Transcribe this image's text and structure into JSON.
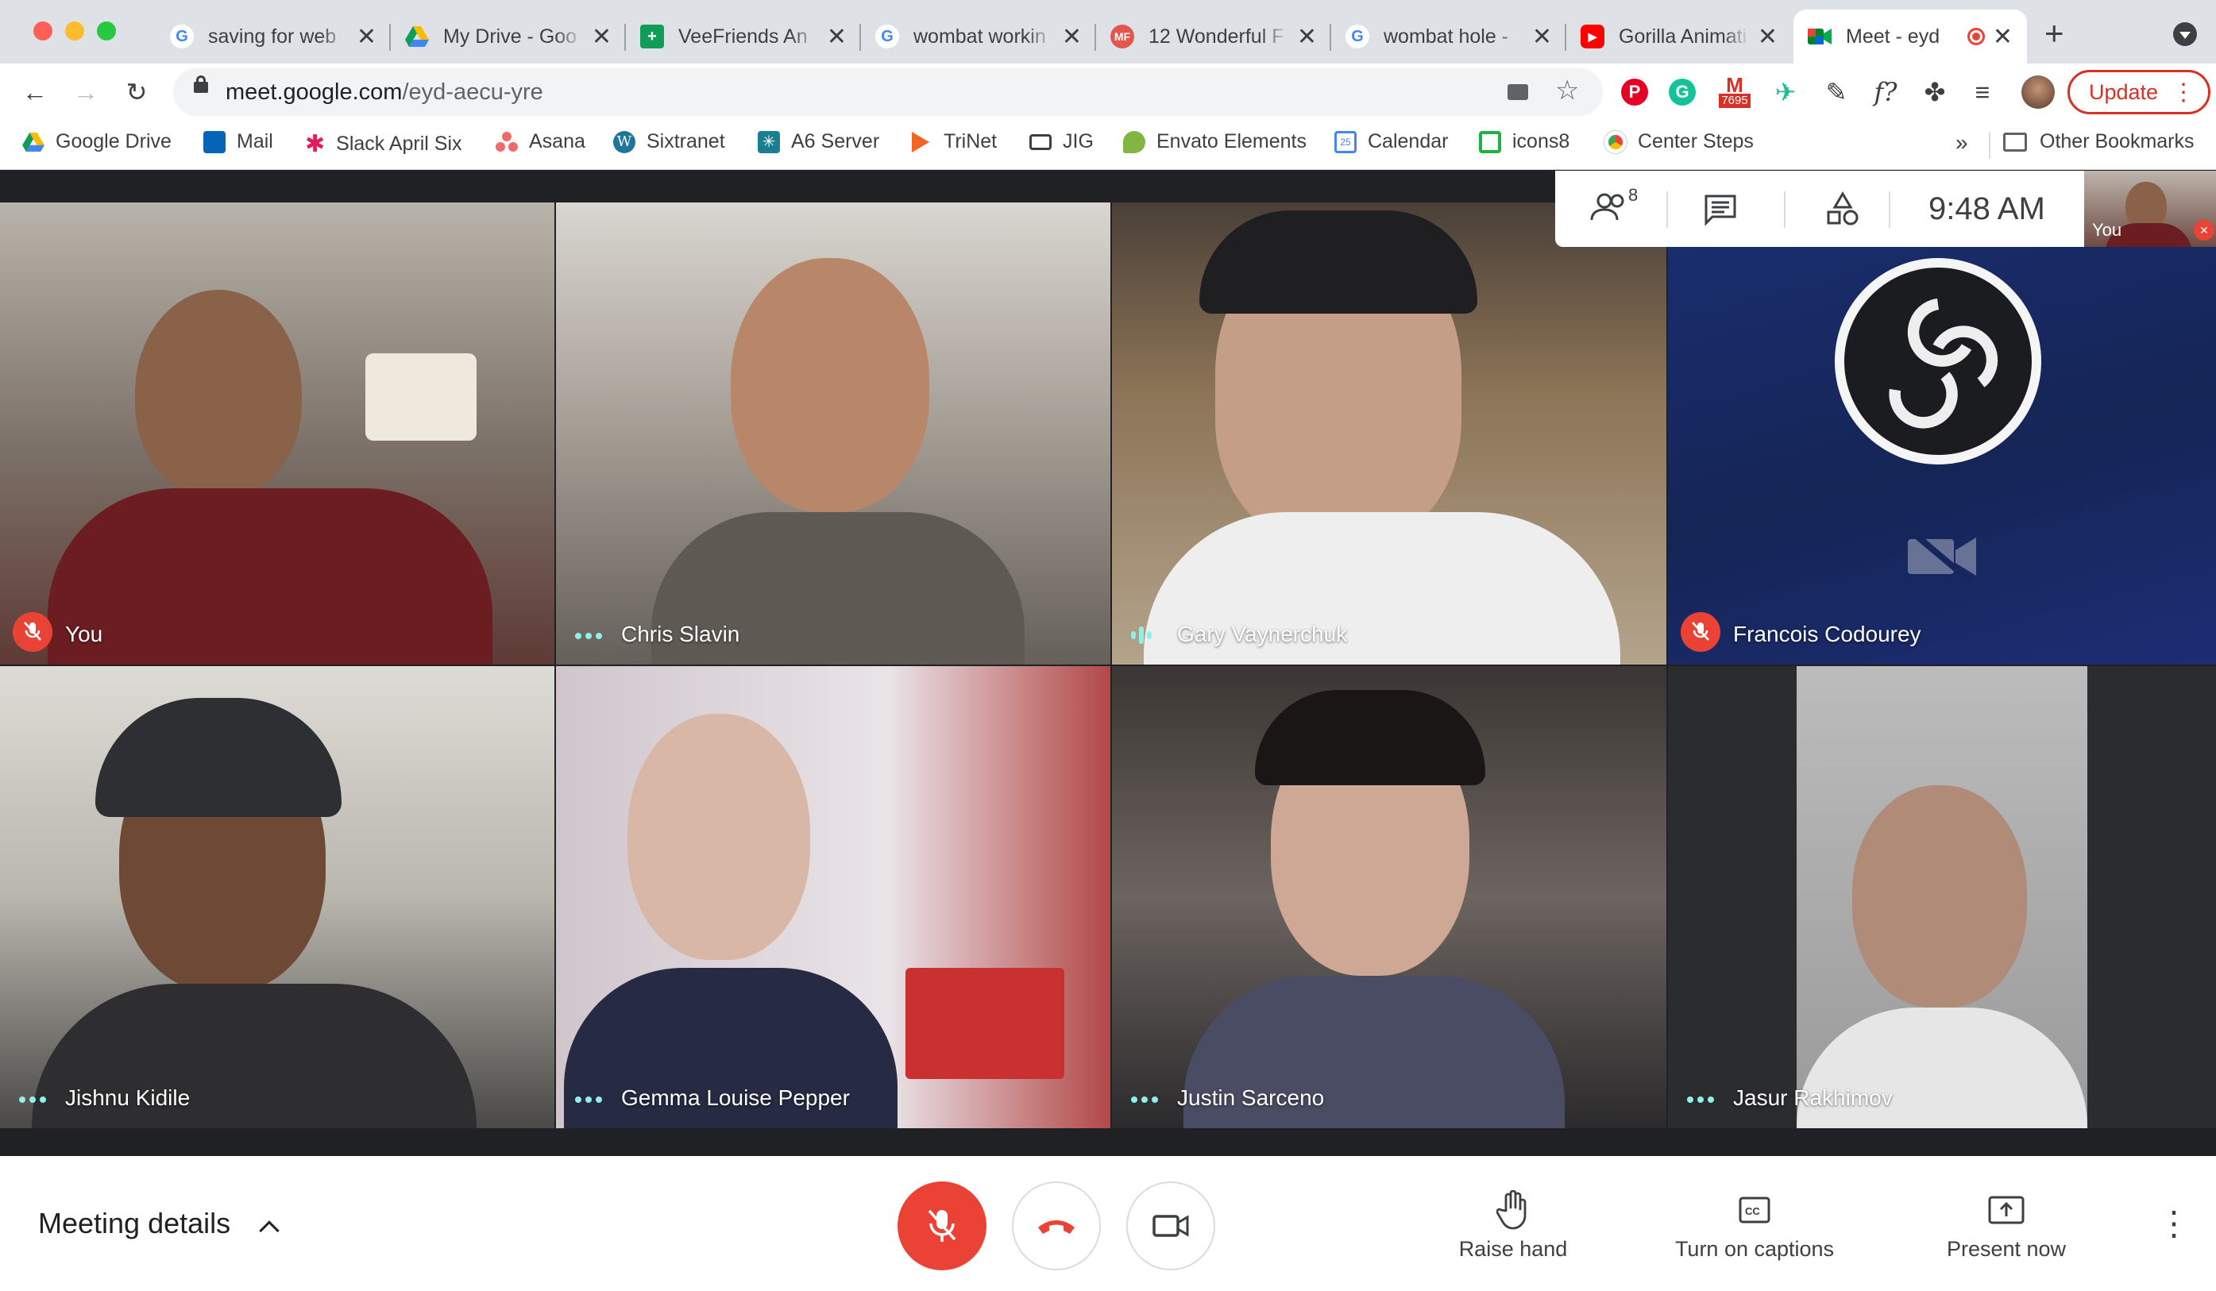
{
  "tabs": [
    {
      "title": "saving for web",
      "favicon": "google-icon"
    },
    {
      "title": "My Drive - Goo",
      "favicon": "google-drive-icon"
    },
    {
      "title": "VeeFriends An",
      "favicon": "google-sheets-icon"
    },
    {
      "title": "wombat workin",
      "favicon": "google-icon"
    },
    {
      "title": "12 Wonderful F",
      "favicon": "mf-icon",
      "favicon_text": "MF"
    },
    {
      "title": "wombat hole -",
      "favicon": "google-icon"
    },
    {
      "title": "Gorilla Animati",
      "favicon": "youtube-icon"
    },
    {
      "title": "Meet - eyd",
      "favicon": "google-meet-icon",
      "active": true
    }
  ],
  "address": {
    "host": "meet.google.com",
    "path": "/eyd-aecu-yre"
  },
  "gmail_badge": "7695",
  "update_label": "Update",
  "bookmarks": [
    {
      "label": "Google Drive",
      "icon": "google-drive-icon",
      "color": "#fbbc04"
    },
    {
      "label": "Mail",
      "icon": "outlook-icon",
      "color": "#0364b8"
    },
    {
      "label": "Slack April Six",
      "icon": "slack-icon",
      "color": "#e01e5a"
    },
    {
      "label": "Asana",
      "icon": "asana-icon",
      "color": "#f06a6a"
    },
    {
      "label": "Sixtranet",
      "icon": "wordpress-icon",
      "color": "#21759b"
    },
    {
      "label": "A6 Server",
      "icon": "a6-icon",
      "color": "#1a7f8e"
    },
    {
      "label": "TriNet",
      "icon": "trinet-icon",
      "color": "#f26522"
    },
    {
      "label": "JIG",
      "icon": "jig-icon",
      "color": "#3c4043"
    },
    {
      "label": "Envato Elements",
      "icon": "envato-icon",
      "color": "#82b541"
    },
    {
      "label": "Calendar",
      "icon": "calendar-icon",
      "color": "#4285f4"
    },
    {
      "label": "icons8",
      "icon": "icons8-icon",
      "color": "#1fb141"
    },
    {
      "label": "Center Steps",
      "icon": "chrome-icon",
      "color": "#5f6368"
    }
  ],
  "other_bookmarks": "Other Bookmarks",
  "meet": {
    "participant_count": "8",
    "time": "9:48 AM",
    "self_label": "You",
    "participants": [
      {
        "name": "You",
        "status": "muted",
        "bg": "#6b5148"
      },
      {
        "name": "Chris Slavin",
        "status": "dots",
        "bg": "#8a8378"
      },
      {
        "name": "Gary Vaynerchuk",
        "status": "talking",
        "bg": "#7d6a55"
      },
      {
        "name": "Francois Codourey",
        "status": "muted",
        "bg": "#152556"
      },
      {
        "name": "Jishnu Kidile",
        "status": "dots",
        "bg": "#9c9a93"
      },
      {
        "name": "Gemma Louise Pepper",
        "status": "dots",
        "bg": "#a79ea6"
      },
      {
        "name": "Justin Sarceno",
        "status": "dots",
        "bg": "#5b5651"
      },
      {
        "name": "Jasur Rakhimov",
        "status": "dots",
        "bg": "#2b2c2e"
      }
    ],
    "footer": {
      "meeting_details": "Meeting details",
      "raise_hand": "Raise hand",
      "captions": "Turn on captions",
      "present": "Present now"
    }
  }
}
